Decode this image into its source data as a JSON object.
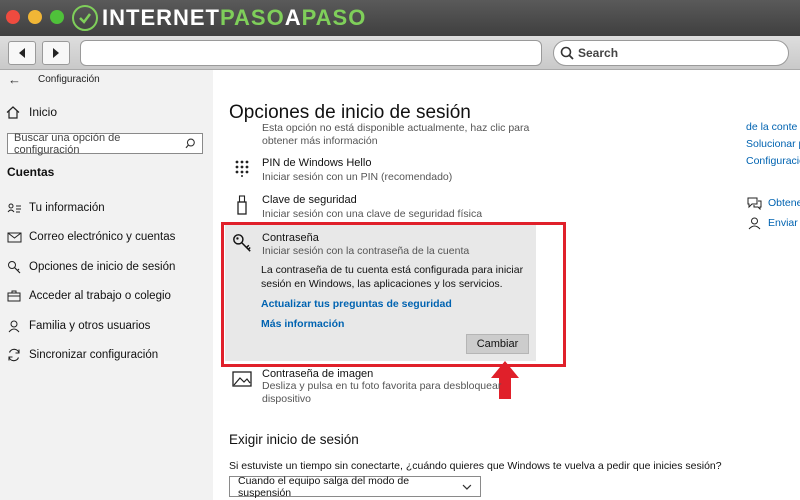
{
  "browser": {
    "logo": {
      "part1": "INTERNET",
      "part2": "PASO",
      "part3": "A",
      "part4": "PASO"
    },
    "search_placeholder": "Search",
    "url_value": ""
  },
  "sidebar": {
    "app_title": "Configuración",
    "home_label": "Inicio",
    "search_placeholder": "Buscar una opción de configuración",
    "section_title": "Cuentas",
    "items": [
      {
        "label": "Tu información",
        "icon": "person-card-icon"
      },
      {
        "label": "Correo electrónico y cuentas",
        "icon": "mail-icon"
      },
      {
        "label": "Opciones de inicio de sesión",
        "icon": "key-icon"
      },
      {
        "label": "Acceder al trabajo o colegio",
        "icon": "briefcase-icon"
      },
      {
        "label": "Familia y otros usuarios",
        "icon": "person-icon"
      },
      {
        "label": "Sincronizar configuración",
        "icon": "sync-icon"
      }
    ]
  },
  "main": {
    "title": "Opciones de inicio de sesión",
    "cut_off_text": {
      "line1": "Esta opción no está disponible actualmente, haz clic para",
      "line2": "obtener más información"
    },
    "options": {
      "pin": {
        "title": "PIN de Windows Hello",
        "desc": "Iniciar sesión con un PIN (recomendado)"
      },
      "security_key": {
        "title": "Clave de seguridad",
        "desc": "Iniciar sesión con una clave de seguridad física"
      },
      "password": {
        "title": "Contraseña",
        "desc": "Iniciar sesión con la contraseña de la cuenta",
        "body": "La contraseña de tu cuenta está configurada para iniciar sesión en Windows, las aplicaciones y los servicios.",
        "link1": "Actualizar tus preguntas de seguridad",
        "link2": "Más información",
        "button": "Cambiar"
      },
      "picture_password": {
        "title": "Contraseña de imagen",
        "desc_line1": "Desliza y pulsa en tu foto favorita para desbloquear",
        "desc_line2": "dispositivo"
      }
    },
    "require_section": {
      "title": "Exigir inicio de sesión",
      "question": "Si estuviste un tiempo sin conectarte, ¿cuándo quieres que Windows te vuelva a pedir que inicies sesión?",
      "dropdown_value": "Cuando el equipo salga del modo de suspensión"
    }
  },
  "right": {
    "links": [
      "de la conte",
      "Solucionar p",
      "Configuracio"
    ],
    "help": [
      {
        "label": "Obtene",
        "icon": "chat-help-icon"
      },
      {
        "label": "Enviar c",
        "icon": "feedback-icon"
      }
    ]
  },
  "colors": {
    "highlight": "#e0202a",
    "link": "#0063b1",
    "sidebar_bg": "#f2f2f2"
  }
}
